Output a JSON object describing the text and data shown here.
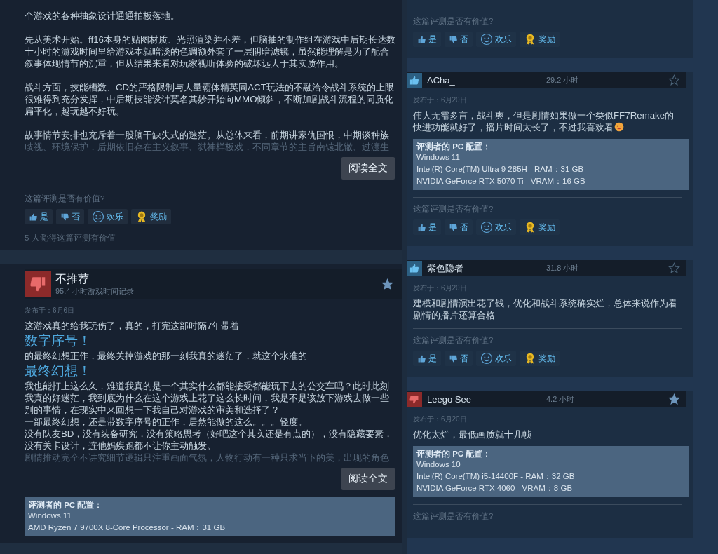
{
  "left_column": {
    "reviews": [
      {
        "body": [
          {
            "kind": "para",
            "text": "个游戏的各种抽象设计通通拍板落地。"
          },
          {
            "kind": "para",
            "text": "先从美术开始。ff16本身的贴图材质、光照渲染并不差，但脑抽的制作组在游戏中后期长达数十小时的游戏时间里给游戏本就暗淡的色调额外套了一层阴暗滤镜，虽然能理解是为了配合叙事体现情节的沉重，但从结果来看对玩家视听体验的破坏远大于其实质作用。"
          },
          {
            "kind": "para",
            "text": "战斗方面，技能槽数、CD的严格限制与大量霸体精英同ACT玩法的不融洽令战斗系统的上限很难得到充分发挥，中后期技能设计莫名其妙开始向MMO倾斜，不断加剧战斗流程的同质化扁平化，越玩越不好玩。"
          },
          {
            "kind": "line",
            "text": "故事情节安排也充斥着一股脑干缺失式的迷茫。从总体来看，前期讲家仇国恨，中期谈种族"
          },
          {
            "kind": "faded",
            "text": "歧视、环境保护，后期依旧存在主义叙事、弑神样板戏，不同章节的主旨南辕北辙、过渡生"
          }
        ],
        "read_more": "阅读全文",
        "helpful_question": "这篇评测是否有价值?",
        "votes": [
          {
            "kind": "yes",
            "label": "是"
          },
          {
            "kind": "no",
            "label": "否"
          },
          {
            "kind": "funny",
            "label": "欢乐"
          },
          {
            "kind": "award",
            "label": "奖励"
          }
        ],
        "helpful_count": "5 人觉得这篇评测有价值"
      },
      {
        "header": {
          "kind": "verdict",
          "recommended": false,
          "title": "不推荐",
          "hours": "95.4 小时游戏时间记录",
          "starred": true
        },
        "posted": "发布于：6月6日",
        "body": [
          {
            "kind": "line",
            "text": "这游戏真的给我玩伤了，真的，打完这部时隔7年带着"
          },
          {
            "kind": "big",
            "text": "数字序号！"
          },
          {
            "kind": "line",
            "text": "的最终幻想正作，最终关掉游戏的那一刻我真的迷茫了，就这个水准的"
          },
          {
            "kind": "big",
            "text": "最终幻想！"
          },
          {
            "kind": "line",
            "text": "我也能打上这么久，难道我真的是一个其实什么都能接受都能玩下去的公交车吗？此时此刻我真的好迷茫，我到底为什么在这个游戏上花了这么长时间，我是不是该放下游戏去做一些别的事情，在现实中来回想一下我自己对游戏的审美和选择了？"
          },
          {
            "kind": "line",
            "text": "一部最终幻想，还是带数字序号的正作，居然能做的这么。。。轻度。"
          },
          {
            "kind": "line",
            "text": "没有队友BD，没有装备研究，没有策略思考（好吧这个其实还是有点的），没有隐藏要素，没有关卡设计，连他妈疾跑都不让你主动触发。"
          },
          {
            "kind": "faded",
            "text": "剧情推动完全不讲究细节逻辑只注重画面气氛，人物行动有一种只求当下的美，出现的角色"
          }
        ],
        "read_more": "阅读全文",
        "pc_config": {
          "title": "评测者的 PC 配置：",
          "lines": [
            "Windows 11",
            "AMD Ryzen 7 9700X 8-Core Processor - RAM：31 GB"
          ]
        }
      }
    ]
  },
  "right_column": {
    "reviews": [
      {
        "helpful_question": "这篇评测是否有价值?",
        "votes": [
          {
            "kind": "yes",
            "label": "是"
          },
          {
            "kind": "no",
            "label": "否"
          },
          {
            "kind": "funny",
            "label": "欢乐"
          },
          {
            "kind": "award",
            "label": "奖励"
          }
        ]
      },
      {
        "header": {
          "kind": "user",
          "recommended": true,
          "title": "ACha_",
          "hours": "29.2 小时",
          "starred": false
        },
        "posted": "发布于：6月20日",
        "body": [
          {
            "kind": "line",
            "text": "伟大无需多言，战斗爽，但是剧情如果做一个类似FF7Remake的快进功能就好了，播片时间太长了，不过我喜欢看",
            "trailing_emoji": true
          }
        ],
        "pc_config": {
          "title": "评测者的 PC 配置：",
          "lines": [
            "Windows 11",
            "Intel(R) Core(TM) Ultra 9 285H - RAM：31 GB",
            "NVIDIA GeForce RTX 5070 Ti - VRAM：16 GB"
          ]
        },
        "helpful_question": "这篇评测是否有价值?",
        "votes": [
          {
            "kind": "yes",
            "label": "是"
          },
          {
            "kind": "no",
            "label": "否"
          },
          {
            "kind": "funny",
            "label": "欢乐"
          },
          {
            "kind": "award",
            "label": "奖励"
          }
        ]
      },
      {
        "header": {
          "kind": "user",
          "recommended": true,
          "title": "紫色隐者",
          "hours": "31.8 小时",
          "starred": false
        },
        "posted": "发布于：6月20日",
        "body": [
          {
            "kind": "line",
            "text": "建模和剧情演出花了钱，优化和战斗系统确实烂，总体来说作为看剧情的播片还算合格"
          }
        ],
        "helpful_question": "这篇评测是否有价值?",
        "votes": [
          {
            "kind": "yes",
            "label": "是"
          },
          {
            "kind": "no",
            "label": "否"
          },
          {
            "kind": "funny",
            "label": "欢乐"
          },
          {
            "kind": "award",
            "label": "奖励"
          }
        ]
      },
      {
        "header": {
          "kind": "user",
          "recommended": false,
          "title": "Leego See",
          "hours": "4.2 小时",
          "starred": true
        },
        "posted": "发布于：6月20日",
        "body": [
          {
            "kind": "line",
            "text": "优化太烂，最低画质就十几帧"
          }
        ],
        "pc_config": {
          "title": "评测者的 PC 配置：",
          "lines": [
            "Windows 10",
            "Intel(R) Core(TM) i5-14400F - RAM：32 GB",
            "NVIDIA GeForce RTX 4060 - VRAM：8 GB"
          ]
        },
        "helpful_question": "这篇评测是否有价值?"
      }
    ]
  }
}
